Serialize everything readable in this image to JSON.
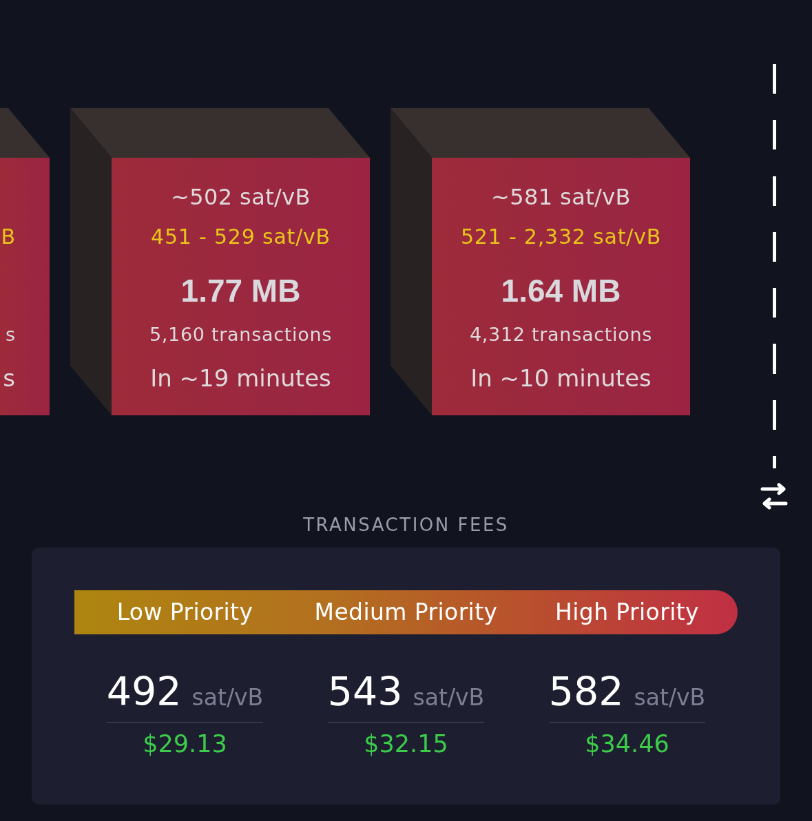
{
  "blocks": [
    {
      "kind": "cut",
      "fee_range": "B",
      "tx_count": "s",
      "eta": "s"
    },
    {
      "kind": "full",
      "median_fee": "~502 sat/vB",
      "fee_range": "451 - 529 sat/vB",
      "size": "1.77 MB",
      "tx_count": "5,160 transactions",
      "eta": "In ~19 minutes"
    },
    {
      "kind": "full",
      "median_fee": "~581 sat/vB",
      "fee_range": "521 - 2,332 sat/vB",
      "size": "1.64 MB",
      "tx_count": "4,312 transactions",
      "eta": "In ~10 minutes"
    }
  ],
  "fees": {
    "title": "TRANSACTION FEES",
    "priorities": [
      {
        "label": "Low Priority",
        "fee": "492",
        "unit": "sat/vB",
        "usd": "$29.13"
      },
      {
        "label": "Medium Priority",
        "fee": "543",
        "unit": "sat/vB",
        "usd": "$32.15"
      },
      {
        "label": "High Priority",
        "fee": "582",
        "unit": "sat/vB",
        "usd": "$34.46"
      }
    ]
  }
}
